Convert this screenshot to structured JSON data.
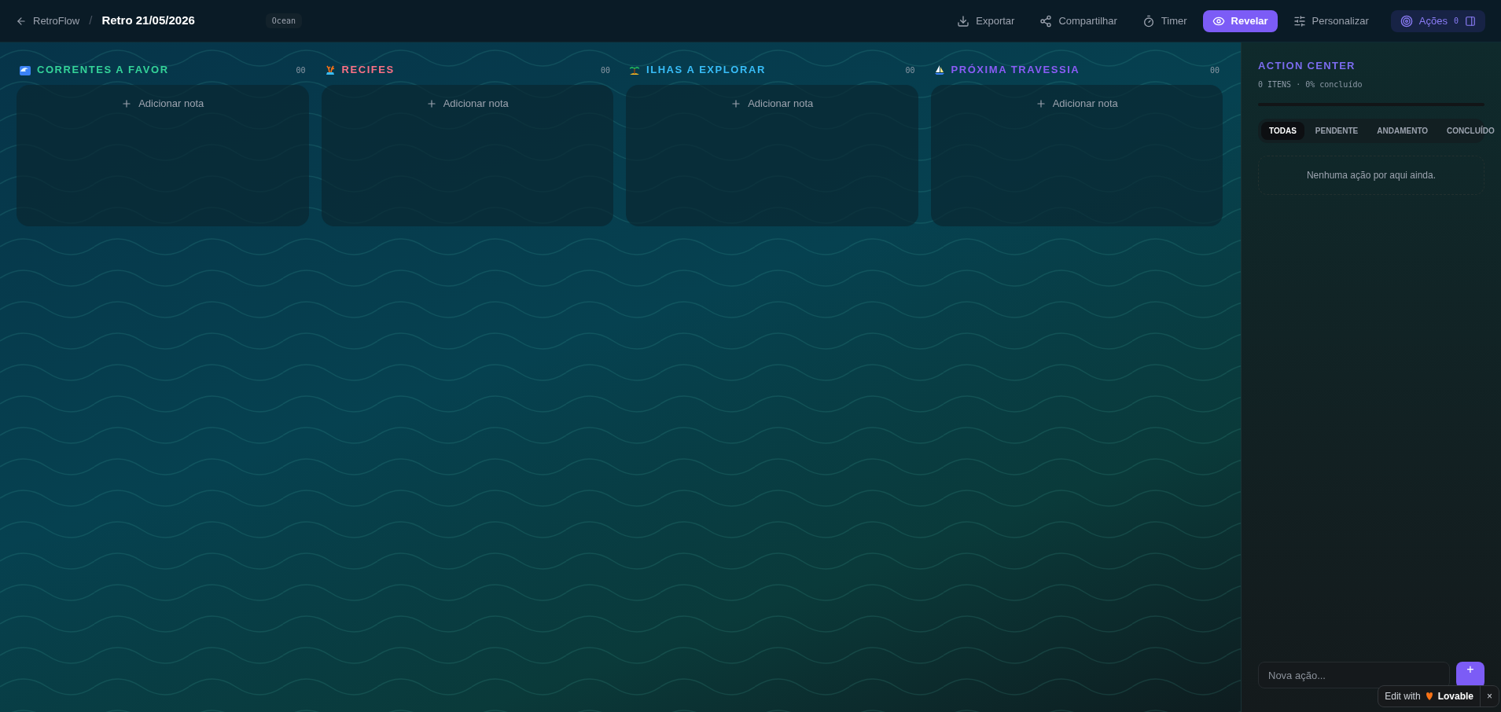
{
  "header": {
    "back_label": "RetroFlow",
    "separator": "/",
    "title": "Retro 21/05/2026",
    "theme_badge": "Ocean",
    "actions": [
      {
        "kind": "export",
        "label": "Exportar",
        "primary": false
      },
      {
        "kind": "share",
        "label": "Compartilhar",
        "primary": false
      },
      {
        "kind": "timer",
        "label": "Timer",
        "primary": false
      },
      {
        "kind": "reveal",
        "label": "Revelar",
        "primary": true
      },
      {
        "kind": "customize",
        "label": "Personalizar",
        "primary": false
      }
    ],
    "actions_toggle": {
      "label": "Ações",
      "count": "0"
    }
  },
  "columns": [
    {
      "kind": "wave",
      "title": "CORRENTES A FAVOR",
      "color": "#34d399",
      "count": "00",
      "add_label": "Adicionar nota"
    },
    {
      "kind": "coral",
      "title": "RECIFES",
      "color": "#fb7185",
      "count": "00",
      "add_label": "Adicionar nota"
    },
    {
      "kind": "island",
      "title": "ILHAS A EXPLORAR",
      "color": "#38bdf8",
      "count": "00",
      "add_label": "Adicionar nota"
    },
    {
      "kind": "sailboat",
      "title": "PRÓXIMA TRAVESSIA",
      "color": "#8b5cf6",
      "count": "00",
      "add_label": "Adicionar nota"
    }
  ],
  "action_center": {
    "title": "ACTION CENTER",
    "summary": "0 ITENS · 0% concluído",
    "progress": {
      "level": 0
    },
    "tabs": [
      {
        "label": "TODAS",
        "selected": true
      },
      {
        "label": "PENDENTE",
        "selected": false
      },
      {
        "label": "ANDAMENTO",
        "selected": false
      },
      {
        "label": "CONCLUÍDO",
        "selected": false
      }
    ],
    "empty_message": "Nenhuma ação por aqui ainda.",
    "new_action": {
      "placeholder": "Nova ação..."
    },
    "add_button": "+"
  },
  "badge": {
    "prefix": "Edit with",
    "brand": "Lovable",
    "close": "×"
  }
}
